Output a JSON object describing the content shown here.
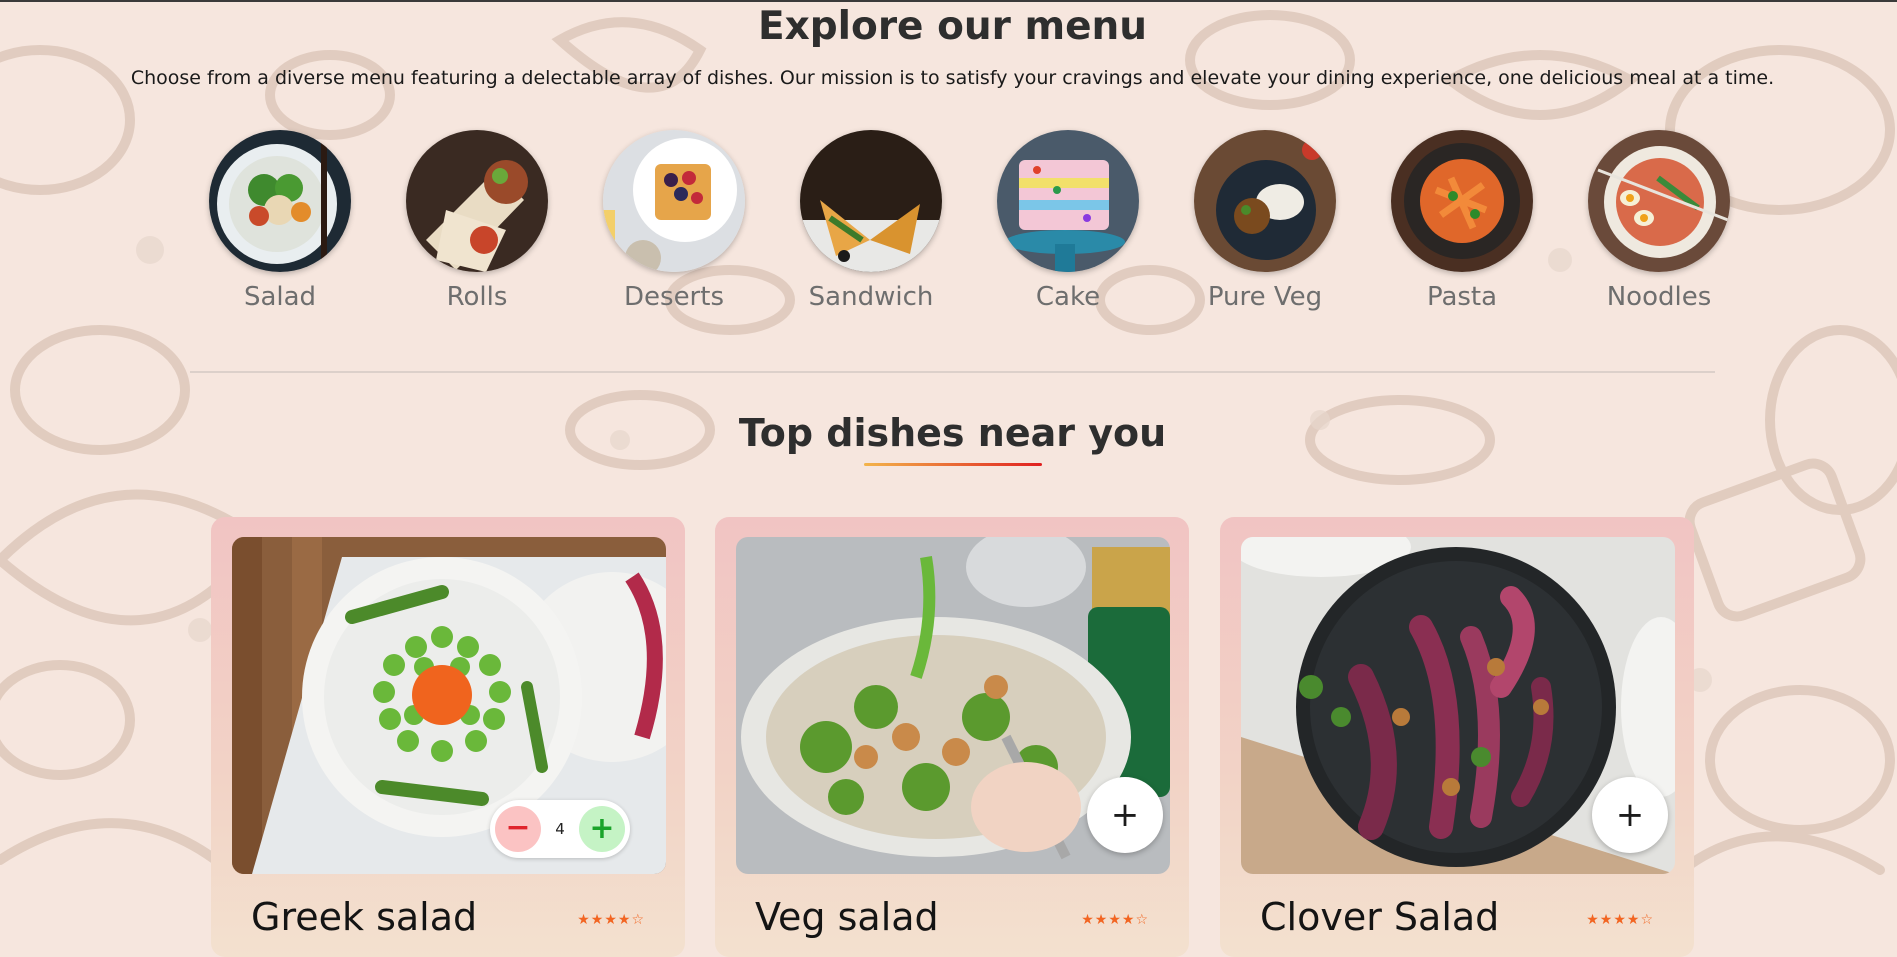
{
  "menu": {
    "title": "Explore our menu",
    "description": "Choose from a diverse menu featuring a delectable array of dishes. Our mission is to satisfy your cravings and elevate your dining experience, one delicious meal at a time."
  },
  "categories": [
    {
      "label": "Salad"
    },
    {
      "label": "Rolls"
    },
    {
      "label": "Deserts"
    },
    {
      "label": "Sandwich"
    },
    {
      "label": "Cake"
    },
    {
      "label": "Pure Veg"
    },
    {
      "label": "Pasta"
    },
    {
      "label": "Noodles"
    }
  ],
  "top_dishes": {
    "title": "Top dishes near you",
    "items": [
      {
        "name": "Greek salad",
        "rating": 4,
        "stars": "★★★★☆",
        "quantity": "4"
      },
      {
        "name": "Veg salad",
        "rating": 4,
        "stars": "★★★★☆",
        "add_icon": "plus-icon"
      },
      {
        "name": "Clover Salad",
        "rating": 4,
        "stars": "★★★★☆",
        "add_icon": "plus-icon"
      }
    ]
  },
  "counter": {
    "minus": "−",
    "plus": "+"
  },
  "add_symbol": "+",
  "colors": {
    "accent_start": "#f3b44a",
    "accent_end": "#e02020",
    "star": "#f26522"
  }
}
